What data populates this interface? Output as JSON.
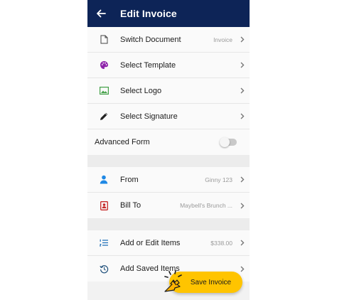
{
  "appbar": {
    "title": "Edit Invoice"
  },
  "group1": [
    {
      "label": "Switch Document",
      "value": "Invoice",
      "icon": "document-icon"
    },
    {
      "label": "Select Template",
      "value": "",
      "icon": "palette-icon"
    },
    {
      "label": "Select Logo",
      "value": "",
      "icon": "image-icon"
    },
    {
      "label": "Select Signature",
      "value": "",
      "icon": "pencil-icon"
    }
  ],
  "advanced": {
    "label": "Advanced Form",
    "enabled": false
  },
  "group2": [
    {
      "label": "From",
      "value": "Ginny 123",
      "icon": "person-icon"
    },
    {
      "label": "Bill To",
      "value": "Maybell's Brunch ...",
      "icon": "contact-card-icon"
    }
  ],
  "group3": [
    {
      "label": "Add or Edit Items",
      "value": "$338.00",
      "icon": "list-icon"
    },
    {
      "label": "Add Saved Items",
      "value": "",
      "icon": "history-icon"
    }
  ],
  "save_button": {
    "label": "Save Invoice"
  },
  "colors": {
    "appbar": "#0d2457",
    "accent": "#ffc400",
    "palette": "#8e24aa",
    "image": "#43a047",
    "person": "#1e88e5",
    "contact": "#c62828",
    "list": "#1e6fb8"
  }
}
